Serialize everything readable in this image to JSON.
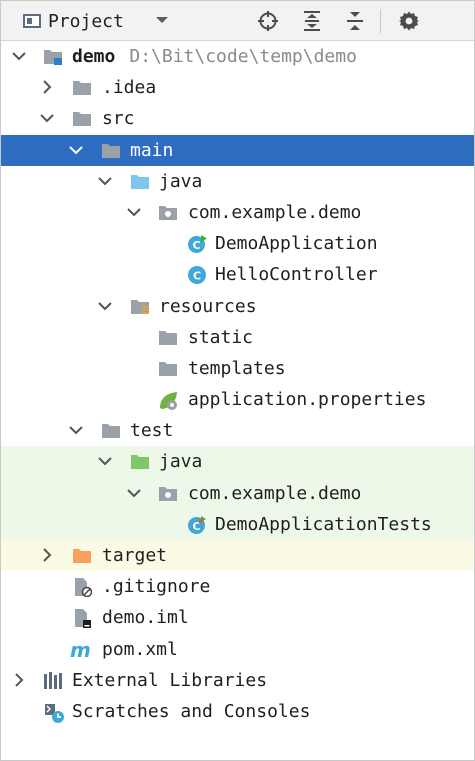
{
  "toolbar": {
    "title": "Project",
    "icons": [
      "project-icon",
      "dropdown-chevron-icon",
      "locate-icon",
      "expand-all-icon",
      "collapse-all-icon",
      "settings-gear-icon"
    ]
  },
  "tree": {
    "root": {
      "name": "demo",
      "path": "D:\\Bit\\code\\temp\\demo"
    },
    "nodes": {
      "idea": ".idea",
      "src": "src",
      "main": "main",
      "java_main": "java",
      "pkg_main": "com.example.demo",
      "demo_app": "DemoApplication",
      "hello_ctrl": "HelloController",
      "resources": "resources",
      "static": "static",
      "templates": "templates",
      "app_props": "application.properties",
      "test": "test",
      "java_test": "java",
      "pkg_test": "com.example.demo",
      "demo_tests": "DemoApplicationTests",
      "target": "target",
      "gitignore": ".gitignore",
      "demo_iml": "demo.iml",
      "pom": "pom.xml",
      "external_libs": "External Libraries",
      "scratches": "Scratches and Consoles"
    }
  },
  "colors": {
    "selection": "#2e6dc0",
    "folder_gray": "#9aa1a8",
    "source_folder": "#7cc7ea",
    "test_folder": "#7ec868",
    "excluded_folder": "#f4a25c",
    "class_icon": "#40a8d8",
    "spring_green": "#6db33f"
  }
}
